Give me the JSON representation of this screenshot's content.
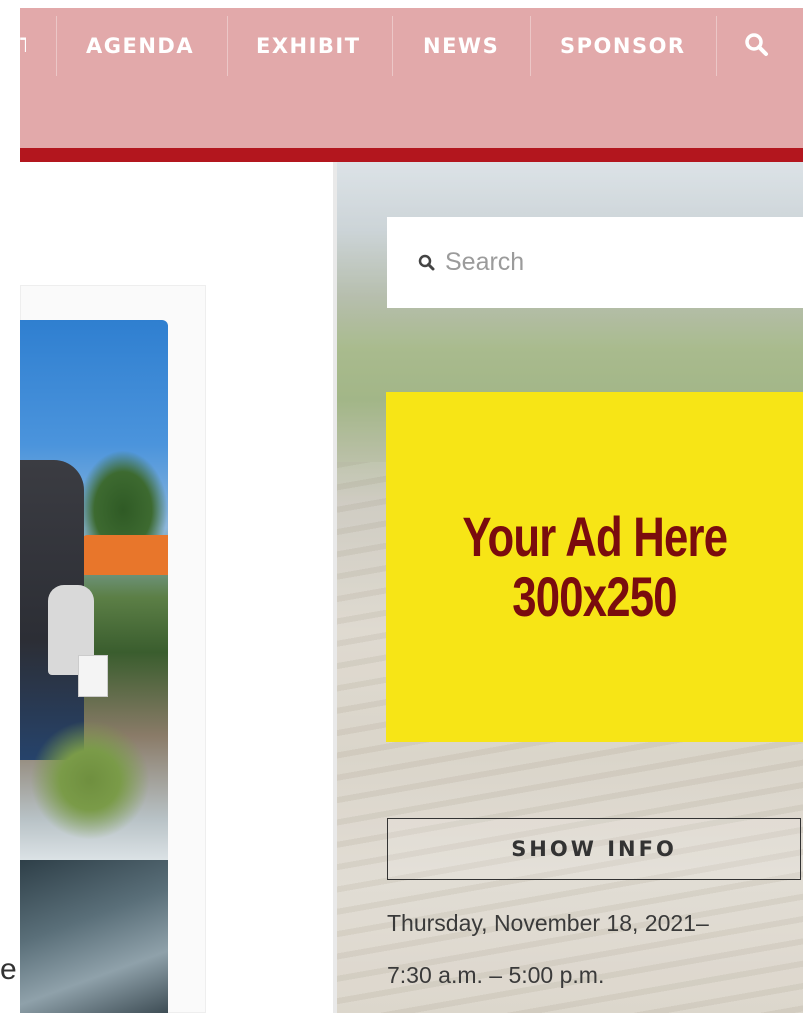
{
  "nav": {
    "items": [
      "AGENDA",
      "EXHIBIT",
      "NEWS",
      "SPONSOR"
    ],
    "cut_item_tail": "T",
    "search_icon": "search-icon"
  },
  "sidebar": {
    "search": {
      "placeholder": "Search",
      "icon": "search-icon"
    },
    "ad": {
      "line1": "Your Ad Here",
      "line2": "300x250"
    },
    "show_info_label": "SHOW INFO",
    "date_line": "Thursday, November 18, 2021–",
    "time_line": "7:30 a.m. – 5:00 p.m."
  },
  "left": {
    "stray_char": "e"
  },
  "colors": {
    "nav_bg": "#e2a9aa",
    "accent_band": "#b3161e",
    "ad_bg": "#f7e516",
    "ad_text": "#7a0c0e"
  }
}
